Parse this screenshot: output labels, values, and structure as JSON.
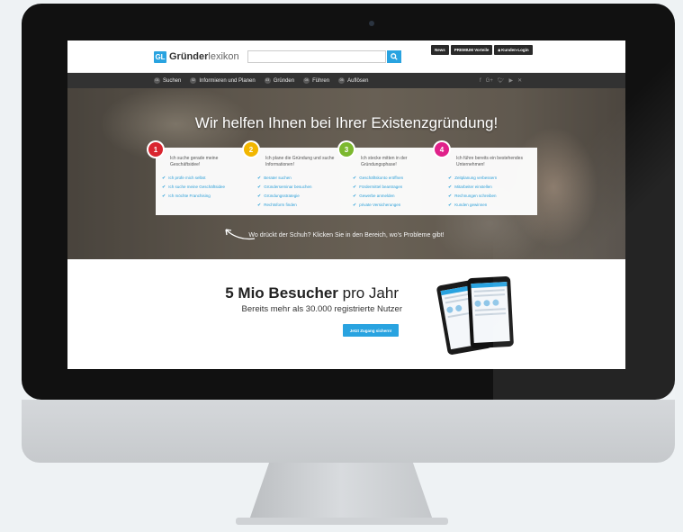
{
  "site": {
    "logo_badge": "GL",
    "logo_bold": "Gründer",
    "logo_light": "lexikon",
    "search_placeholder": "",
    "top_links": [
      "News",
      "PREMIUM Vorteile",
      "Kunden-Login"
    ]
  },
  "nav": {
    "items": [
      {
        "num": "01",
        "label": "Suchen"
      },
      {
        "num": "02",
        "label": "Informieren und Planen"
      },
      {
        "num": "03",
        "label": "Gründen"
      },
      {
        "num": "04",
        "label": "Führen"
      },
      {
        "num": "05",
        "label": "Auflösen"
      }
    ],
    "social_icons": [
      "facebook-icon",
      "google-plus-icon",
      "twitter-icon",
      "youtube-icon",
      "xing-icon"
    ]
  },
  "hero": {
    "title": "Wir helfen Ihnen bei Ihrer Existenzgründung!",
    "bottom_text": "Wo drückt der Schuh? Klicken Sie in den Bereich, wo's Probleme gibt!",
    "cards": [
      {
        "num": "1",
        "color": "#d9252f",
        "title": "Ich suche gerade meine Geschäftsidee!",
        "items": [
          "Ich prüfe mich selbst",
          "Ich suche meine Geschäftsidee",
          "Ich möchte Franchising"
        ]
      },
      {
        "num": "2",
        "color": "#f2b600",
        "title": "Ich plane die Gründung und suche Informationen!",
        "items": [
          "Berater suchen",
          "Gründerseminar besuchen",
          "Gründungsstrategie",
          "Rechtsform finden"
        ]
      },
      {
        "num": "3",
        "color": "#7cb82f",
        "title": "Ich stecke mitten in der Gründungsphase!",
        "items": [
          "Geschäftskonto eröffnen",
          "Fördermittel beantragen",
          "Gewerbe anmelden",
          "private Versicherungen"
        ]
      },
      {
        "num": "4",
        "color": "#e0218a",
        "title": "Ich führe bereits ein bestehendes Unternehmen!",
        "items": [
          "Zeitplanung verbessern",
          "Mitarbeiter einstellen",
          "Rechnungen schreiben",
          "Kunden gewinnen"
        ]
      }
    ]
  },
  "stats": {
    "headline_bold": "5 Mio Besucher",
    "headline_rest": " pro Jahr",
    "subline": "Bereits mehr als 30.000 registrierte Nutzer",
    "button_label": "Jetzt Zugang sichern!"
  },
  "colors": {
    "accent": "#29a3e0",
    "nav_bg": "#323232"
  }
}
